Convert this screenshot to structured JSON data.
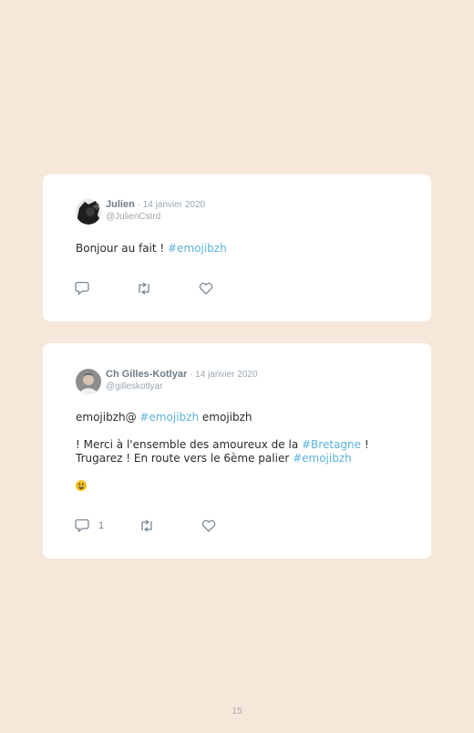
{
  "tweets": [
    {
      "name": "Julien",
      "date": "· 14 janvier 2020",
      "handle": "@JulienCstrd",
      "text_before": "Bonjour au fait ! ",
      "hashtag": "#emojibzh",
      "icons": [
        "reply-icon",
        "retweet-icon",
        "like-icon"
      ]
    },
    {
      "name": "Ch Gilles-Kotlyar",
      "date": "· 14 janvier 2020",
      "handle": "@gilleskotlyar",
      "line1_before": "emojibzh@ ",
      "line1_tag": "#emojibzh",
      "line1_after": " emojibzh",
      "line2_before": "! Merci à l'ensemble des amoureux de la ",
      "line2_tag": "#Bretagne",
      "line2_after": " !",
      "line3_before": "Trugarez ! En route vers le 6ème palier ",
      "line3_tag": "#emojibzh",
      "emoji": "grinning-face-emoji",
      "reply_count": "1",
      "icons": [
        "reply-icon",
        "retweet-icon",
        "like-icon"
      ]
    }
  ],
  "page_number": "15",
  "colors": {
    "background": "#f5e8da",
    "card": "#ffffff",
    "hashtag": "#5bb3da",
    "meta": "#9aa7b0"
  }
}
